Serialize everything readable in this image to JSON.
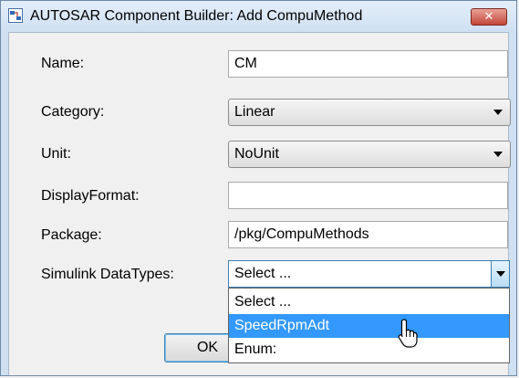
{
  "window": {
    "title": "AUTOSAR Component Builder: Add CompuMethod",
    "close_label": "✕"
  },
  "form": {
    "name": {
      "label": "Name:",
      "value": "CM"
    },
    "category": {
      "label": "Category:",
      "value": "Linear"
    },
    "unit": {
      "label": "Unit:",
      "value": "NoUnit"
    },
    "display_format": {
      "label": "DisplayFormat:",
      "value": ""
    },
    "package": {
      "label": "Package:",
      "value": "/pkg/CompuMethods"
    },
    "simulink_datatypes": {
      "label": "Simulink DataTypes:",
      "value": "Select ...",
      "options": [
        "Select ...",
        "SpeedRpmAdt",
        "Enum:"
      ],
      "highlighted_option": "SpeedRpmAdt"
    }
  },
  "buttons": {
    "ok_label": "OK",
    "cancel_label": "",
    "help_label": ""
  },
  "colors": {
    "selection": "#3399ff",
    "title_bar": "#cfe0f2",
    "close_button": "#c2453a"
  }
}
